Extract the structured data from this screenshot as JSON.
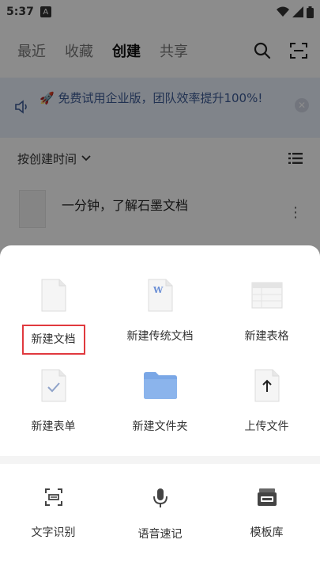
{
  "status": {
    "time": "5:37",
    "badge": "A"
  },
  "tabs": [
    {
      "label": "最近",
      "active": false
    },
    {
      "label": "收藏",
      "active": false
    },
    {
      "label": "创建",
      "active": true
    },
    {
      "label": "共享",
      "active": false
    }
  ],
  "banner": {
    "text": "🚀 免费试用企业版，团队效率提升100%!"
  },
  "sort": {
    "label": "按创建时间"
  },
  "file": {
    "name": "一分钟，了解石墨文档"
  },
  "sheet": {
    "create_items": [
      {
        "label": "新建文档",
        "icon": "doc-icon"
      },
      {
        "label": "新建传统文档",
        "icon": "word-doc-icon"
      },
      {
        "label": "新建表格",
        "icon": "sheet-icon"
      },
      {
        "label": "新建表单",
        "icon": "form-icon"
      },
      {
        "label": "新建文件夹",
        "icon": "folder-icon"
      },
      {
        "label": "上传文件",
        "icon": "upload-icon"
      }
    ],
    "tools": [
      {
        "label": "文字识别",
        "icon": "ocr-scan-icon"
      },
      {
        "label": "语音速记",
        "icon": "microphone-icon"
      },
      {
        "label": "模板库",
        "icon": "template-library-icon"
      }
    ]
  },
  "colors": {
    "highlight": "#e0393e",
    "banner_bg": "#eaf0fb",
    "banner_text": "#3d5b95",
    "folder": "#7aa7e6"
  }
}
